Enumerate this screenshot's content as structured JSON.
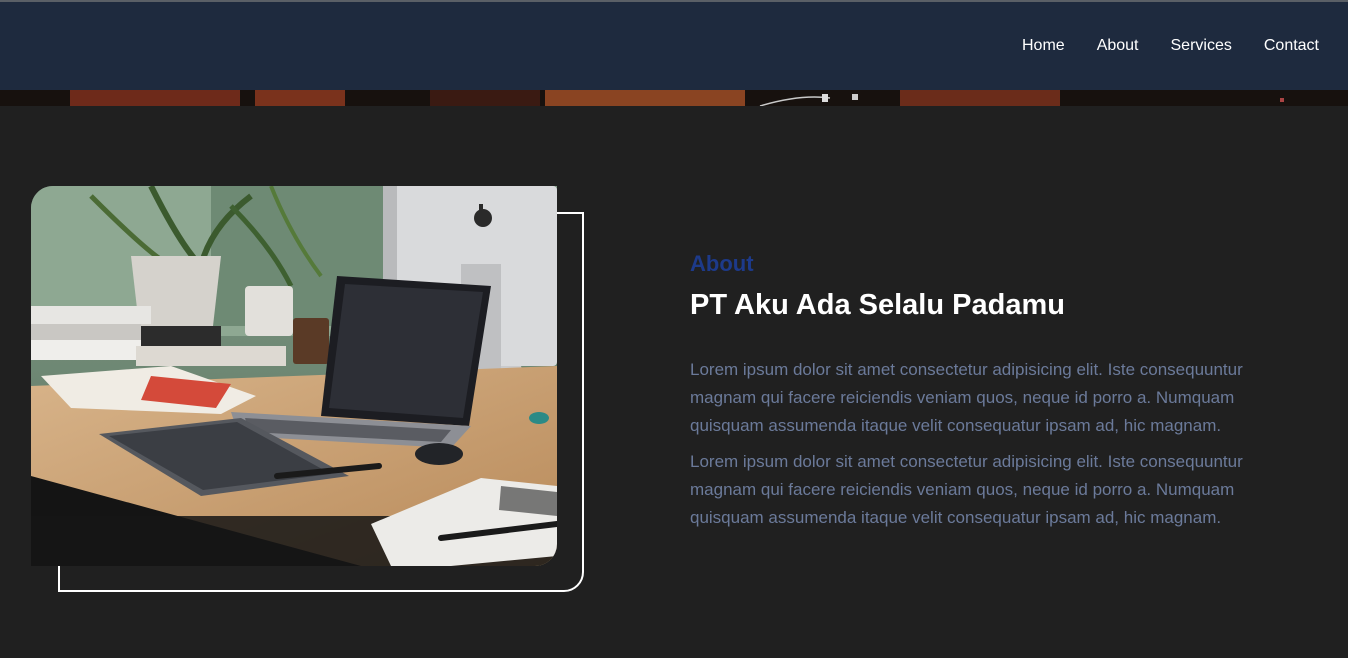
{
  "nav": {
    "items": [
      "Home",
      "About",
      "Services",
      "Contact"
    ]
  },
  "about": {
    "label": "About",
    "title": "PT Aku Ada Selalu Padamu",
    "paragraphs": [
      "Lorem ipsum dolor sit amet consectetur adipisicing elit. Iste consequuntur magnam qui facere reiciendis veniam quos, neque id porro a. Numquam quisquam assumenda itaque velit consequatur ipsam ad, hic magnam.",
      "Lorem ipsum dolor sit amet consectetur adipisicing elit. Iste consequuntur magnam qui facere reiciendis veniam quos, neque id porro a. Numquam quisquam assumenda itaque velit consequatur ipsam ad, hic magnam."
    ]
  },
  "colors": {
    "navbar": "#1e2a3e",
    "background": "#202020",
    "accent": "#1d3a8a",
    "body_text": "#6b7a9a"
  }
}
